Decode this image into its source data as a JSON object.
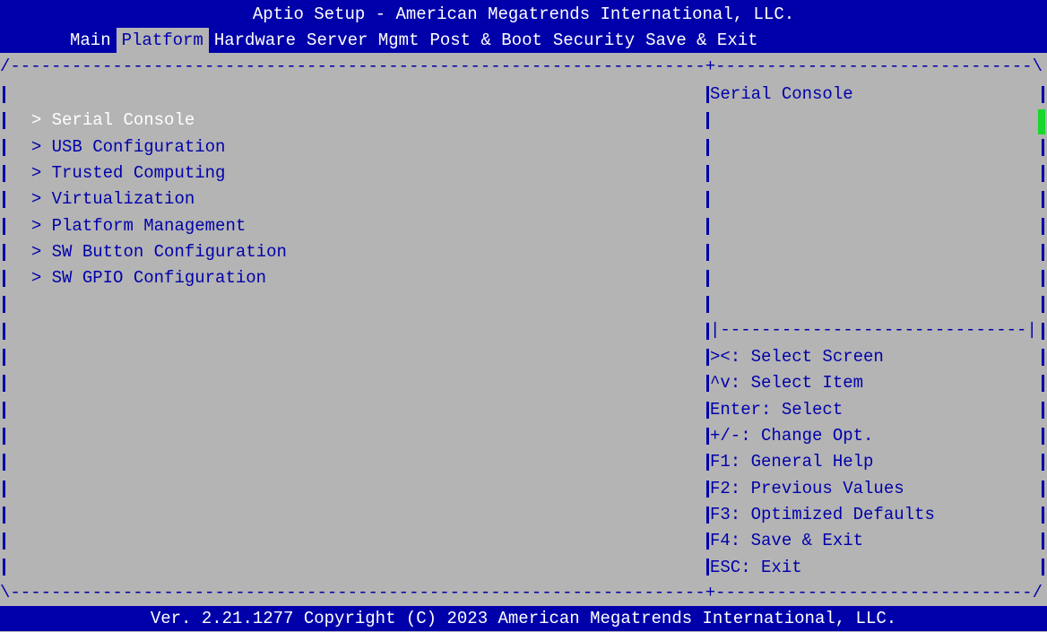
{
  "header": {
    "title": "Aptio Setup - American Megatrends International, LLC."
  },
  "tabs": [
    {
      "label": "Main"
    },
    {
      "label": "Platform"
    },
    {
      "label": "Hardware"
    },
    {
      "label": "Server Mgmt"
    },
    {
      "label": "Post & Boot"
    },
    {
      "label": "Security"
    },
    {
      "label": "Save & Exit"
    }
  ],
  "menu": {
    "items": [
      {
        "label": "Serial Console"
      },
      {
        "label": "USB Configuration"
      },
      {
        "label": "Trusted Computing"
      },
      {
        "label": "Virtualization"
      },
      {
        "label": "Platform Management"
      },
      {
        "label": "SW Button Configuration"
      },
      {
        "label": "SW GPIO Configuration"
      }
    ],
    "arrow": "> "
  },
  "help": {
    "title": "Serial Console"
  },
  "hints": [
    {
      "text": "><: Select Screen"
    },
    {
      "text": "^v: Select Item"
    },
    {
      "text": "Enter: Select"
    },
    {
      "text": "+/-: Change Opt."
    },
    {
      "text": "F1: General Help"
    },
    {
      "text": "F2: Previous Values"
    },
    {
      "text": "F3: Optimized Defaults"
    },
    {
      "text": "F4: Save & Exit"
    },
    {
      "text": "ESC: Exit"
    }
  ],
  "footer": {
    "text": "Ver. 2.21.1277 Copyright (C) 2023 American Megatrends International, LLC."
  },
  "colors": {
    "background": "#b4b4b4",
    "header_bg": "#0000aa",
    "text": "#0000aa",
    "highlight_text": "#ffffff",
    "scroll_thumb": "#17d82a"
  }
}
